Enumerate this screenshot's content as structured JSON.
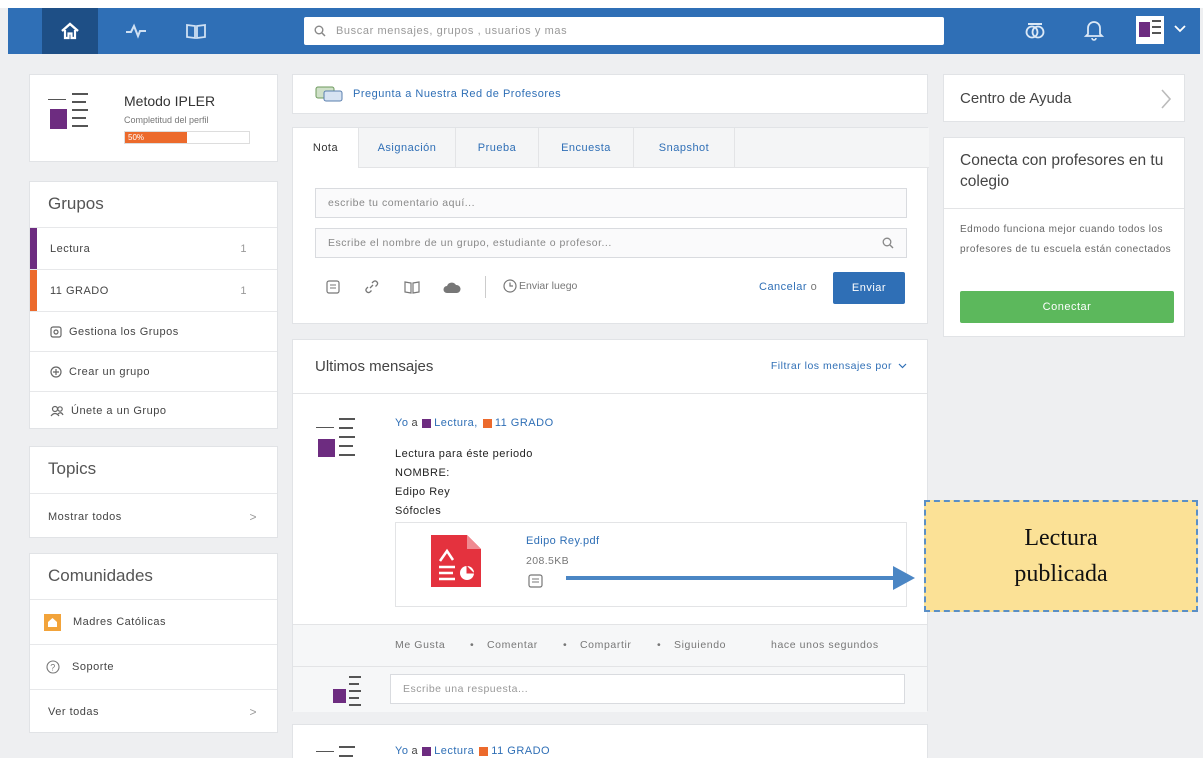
{
  "topbar": {
    "search_placeholder": "Buscar mensajes, grupos , usuarios y mas",
    "icons": [
      "home-icon",
      "activity-icon",
      "library-icon",
      "search-icon",
      "backpack-icon",
      "bell-icon",
      "profile-avatar"
    ]
  },
  "profile": {
    "name": "Metodo IPLER",
    "completion_label": "Completitud del perfil",
    "progress": "50%",
    "progress_value": 0.5
  },
  "groups": {
    "title": "Grupos",
    "items": [
      {
        "name": "Lectura",
        "count": "1",
        "color": "#6d2c80"
      },
      {
        "name": "11 GRADO",
        "count": "1",
        "color": "#ec6a2c"
      }
    ],
    "actions": [
      "Gestiona los Grupos",
      "Crear un grupo",
      "Únete a un Grupo"
    ]
  },
  "topics": {
    "title": "Topics",
    "show_all": "Mostrar todos"
  },
  "communities": {
    "title": "Comunidades",
    "items": [
      "Madres Católicas",
      "Soporte"
    ],
    "see_all": "Ver todas"
  },
  "ask_banner": "Pregunta a Nuestra Red de Profesores",
  "composer": {
    "tabs": [
      "Nota",
      "Asignación",
      "Prueba",
      "Encuesta",
      "Snapshot"
    ],
    "comment_placeholder": "escribe tu comentario aquí...",
    "recipients_placeholder": "Escribe el nombre de un grupo, estudiante o profesor...",
    "send_later": "Enviar luego",
    "cancel": "Cancelar",
    "or": "o",
    "send": "Enviar"
  },
  "messages": {
    "title": "Ultimos mensajes",
    "filter": "Filtrar los mensajes por",
    "post": {
      "from": "Yo",
      "to": "a",
      "group1": "Lectura,",
      "group2": "11 GRADO",
      "lines": [
        "Lectura para éste periodo",
        "NOMBRE:",
        "Edipo Rey",
        "Sófocles"
      ],
      "attachment_name": "Edipo Rey.pdf",
      "attachment_size": "208.5KB",
      "actions": [
        "Me Gusta",
        "Comentar",
        "Compartir",
        "Siguiendo"
      ],
      "time": "hace unos segundos",
      "reply_placeholder": "Escribe una respuesta..."
    },
    "post2": {
      "from": "Yo",
      "to": "a",
      "group1": "Lectura",
      "group2": "11 GRADO"
    }
  },
  "help": {
    "title": "Centro de Ayuda"
  },
  "connect": {
    "title": "Conecta con profesores en tu colegio",
    "body": "Edmodo funciona mejor cuando todos los profesores de tu escuela están conectados",
    "button": "Conectar"
  },
  "callout": {
    "line1": "Lectura",
    "line2": "publicada"
  },
  "colors": {
    "topbar": "#2f6fb6",
    "accent": "#2f6fb6",
    "progress": "#ec6a2c",
    "connect": "#5cb85c"
  }
}
